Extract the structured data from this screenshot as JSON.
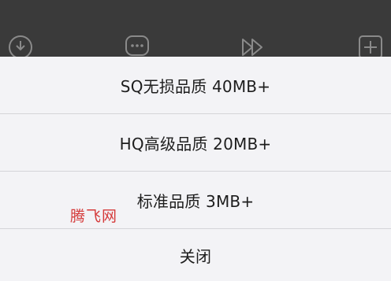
{
  "toolbar": {
    "icons": [
      "download-icon",
      "comment-icon",
      "fast-forward-icon",
      "add-icon"
    ]
  },
  "quality_sheet": {
    "options": [
      {
        "label": "SQ无损品质 40MB+"
      },
      {
        "label": "HQ高级品质 20MB+"
      },
      {
        "label": "标准品质 3MB+"
      }
    ],
    "close_label": "关闭"
  },
  "watermark": {
    "text": "腾飞网",
    "color": "#d53a3a"
  },
  "colors": {
    "sheet_background": "#f3f3f6",
    "backdrop": "#3a3a3a",
    "divider": "#d4d4d8",
    "text": "#1d1d1d"
  }
}
